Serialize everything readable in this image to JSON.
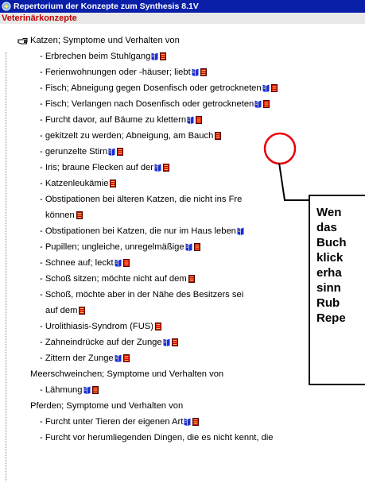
{
  "window": {
    "title": "Repertorium der Konzepte zum Synthesis 8.1V",
    "subtitle": "Veterinärkonzepte"
  },
  "rows": [
    {
      "text": "Katzen; Symptome und Verhalten von",
      "level": 0,
      "book": false,
      "note": false,
      "hand": true
    },
    {
      "text": "- Erbrechen beim Stuhlgang",
      "level": 1,
      "book": true,
      "note": true
    },
    {
      "text": "- Ferienwohnungen oder -häuser; liebt",
      "level": 1,
      "book": true,
      "note": true
    },
    {
      "text": "- Fisch; Abneigung gegen Dosenfisch oder getrockneten",
      "level": 1,
      "book": true,
      "note": true
    },
    {
      "text": "- Fisch; Verlangen nach Dosenfisch oder getrockneten",
      "level": 1,
      "book": true,
      "note": true
    },
    {
      "text": "- Furcht davor, auf Bäume zu klettern",
      "level": 1,
      "book": true,
      "note": true
    },
    {
      "text": "- gekitzelt zu werden; Abneigung, am Bauch",
      "level": 1,
      "book": false,
      "note": true
    },
    {
      "text": "- gerunzelte Stirn",
      "level": 1,
      "book": true,
      "note": true
    },
    {
      "text": "- Iris; braune Flecken auf der",
      "level": 1,
      "book": true,
      "note": true
    },
    {
      "text": "- Katzenleukämie",
      "level": 1,
      "book": false,
      "note": true
    },
    {
      "text": "- Obstipationen bei älteren Katzen, die nicht ins Fre",
      "level": 1,
      "book": false,
      "note": false
    },
    {
      "text": "können",
      "level": 1,
      "cont": true,
      "book": false,
      "note": true
    },
    {
      "text": "- Obstipationen bei Katzen, die nur im Haus leben",
      "level": 1,
      "book": true,
      "note": false
    },
    {
      "text": "- Pupillen; ungleiche, unregelmäßige",
      "level": 1,
      "book": true,
      "note": true
    },
    {
      "text": "- Schnee auf; leckt",
      "level": 1,
      "book": true,
      "note": true
    },
    {
      "text": "- Schoß sitzen; möchte nicht auf dem",
      "level": 1,
      "book": false,
      "note": true
    },
    {
      "text": "- Schoß, möchte aber in der Nähe des Besitzers sei",
      "level": 1,
      "book": false,
      "note": false
    },
    {
      "text": "auf dem",
      "level": 1,
      "cont": true,
      "book": false,
      "note": true
    },
    {
      "text": "- Urolithiasis-Syndrom (FUS)",
      "level": 1,
      "book": false,
      "note": true
    },
    {
      "text": "- Zahneindrücke auf der Zunge",
      "level": 1,
      "book": true,
      "note": true
    },
    {
      "text": "- Zittern der Zunge",
      "level": 1,
      "book": true,
      "note": true
    },
    {
      "text": "Meerschweinchen; Symptome und Verhalten von",
      "level": 0,
      "book": false,
      "note": false
    },
    {
      "text": "- Lähmung",
      "level": 1,
      "book": true,
      "note": true
    },
    {
      "text": "Pferden; Symptome und Verhalten von",
      "level": 0,
      "book": false,
      "note": false
    },
    {
      "text": "- Furcht unter Tieren der eigenen Art",
      "level": 1,
      "book": true,
      "note": true
    },
    {
      "text": "- Furcht vor herumliegenden Dingen, die es nicht kennt, die",
      "level": 1,
      "book": false,
      "note": false
    }
  ],
  "callout": {
    "lines": [
      "Wen",
      "das",
      "Buch",
      "klick",
      "erha",
      "sinn",
      "Rub",
      "Repe"
    ]
  },
  "colors": {
    "titlebar": "#0a1fa8",
    "subtitle_text": "#c00000",
    "highlight_circle": "#e8000a",
    "book_icon": "#1a2fd8",
    "note_icon": "#d40000"
  }
}
